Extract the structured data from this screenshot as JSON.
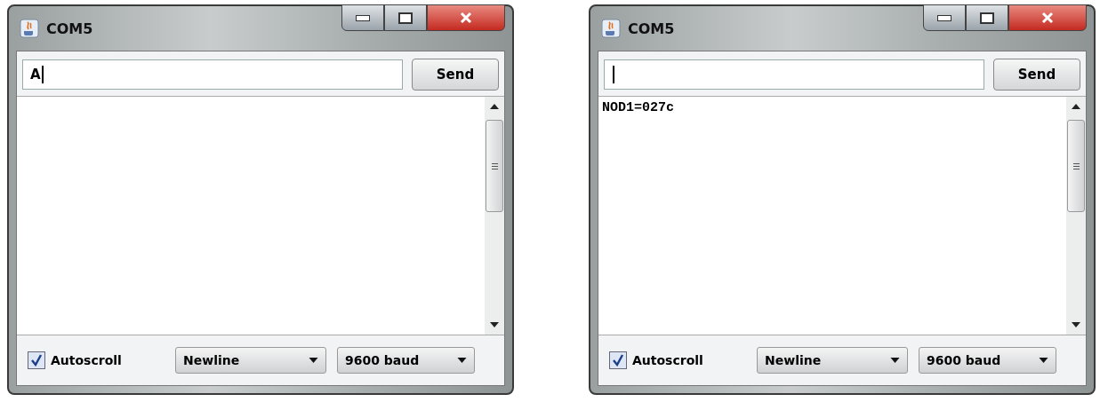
{
  "windows": [
    {
      "title": "COM5",
      "input": {
        "value": "A"
      },
      "send_button": "Send",
      "autoscroll": {
        "label": "Autoscroll",
        "checked": true
      },
      "line_ending": "Newline",
      "baud_rate": "9600 baud"
    },
    {
      "title": "COM5",
      "send_button": "Send",
      "output": [
        "NOD1=027c"
      ],
      "autoscroll": {
        "label": "Autoscroll",
        "checked": true
      },
      "line_ending": "Newline",
      "baud_rate": "9600 baud"
    }
  ]
}
